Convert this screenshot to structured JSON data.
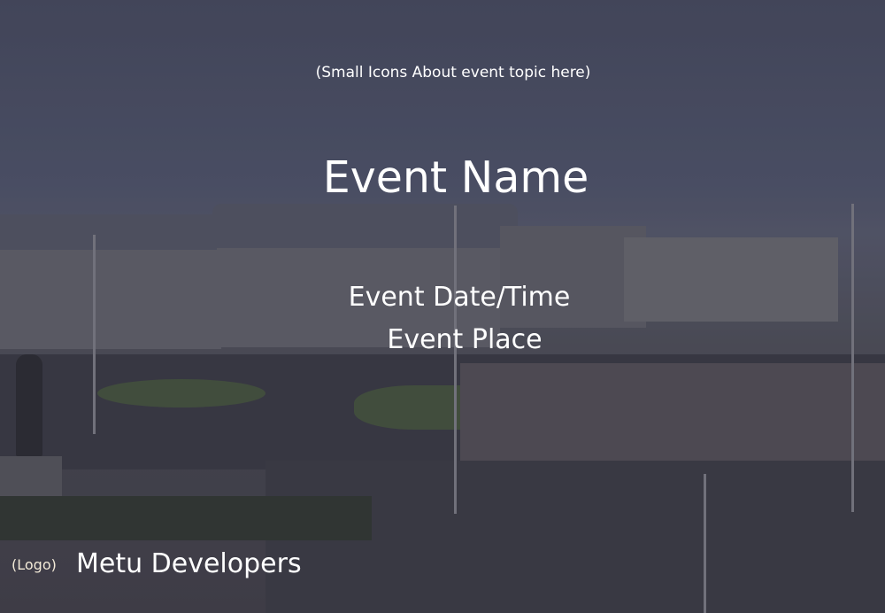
{
  "header": {
    "icons_placeholder": "(Small Icons About event topic here)"
  },
  "event": {
    "name": "Event Name",
    "date_time": "Event Date/Time",
    "place": "Event Place"
  },
  "footer": {
    "logo_placeholder": "(Logo)",
    "organizer": "Metu Developers"
  }
}
